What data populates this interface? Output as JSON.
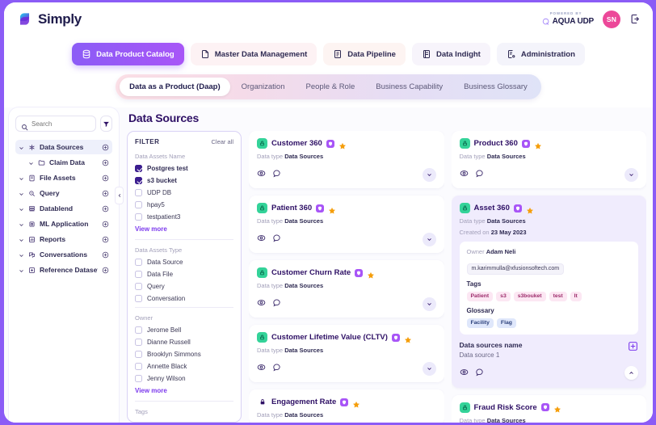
{
  "header": {
    "brand": "Simply",
    "brand_logo_icon": "simply-logo-icon",
    "powered_by_label": "POWERED BY",
    "powered_by_name": "AQUA UDP",
    "avatar_initials": "SN",
    "logout_icon": "logout-icon",
    "avatar_color": "#ec4899"
  },
  "main_nav": {
    "tabs": [
      {
        "label": "Data Product Catalog",
        "icon": "database-icon",
        "active": true
      },
      {
        "label": "Master Data Management",
        "icon": "document-icon",
        "active": false
      },
      {
        "label": "Data Pipeline",
        "icon": "list-document-icon",
        "active": false
      },
      {
        "label": "Data Indight",
        "icon": "book-icon",
        "active": false
      },
      {
        "label": "Administration",
        "icon": "admin-document-icon",
        "active": false
      }
    ]
  },
  "sub_nav": {
    "tabs": [
      {
        "label": "Data as a Product (Daap)",
        "active": true
      },
      {
        "label": "Organization",
        "active": false
      },
      {
        "label": "People & Role",
        "active": false
      },
      {
        "label": "Business Capability",
        "active": false
      },
      {
        "label": "Business Glossary",
        "active": false
      }
    ]
  },
  "sidebar": {
    "search": {
      "placeholder": "Search",
      "value": "",
      "icon": "search-icon"
    },
    "filter_button_icon": "filter-funnel-icon",
    "collapse_handle_icon": "chevron-left-icon",
    "items": [
      {
        "label": "Data Sources",
        "icon": "asterisk-icon",
        "selected": true,
        "child": false
      },
      {
        "label": "Claim Data",
        "icon": "folder-icon",
        "selected": false,
        "child": true
      },
      {
        "label": "File Assets",
        "icon": "file-icon",
        "selected": false,
        "child": false
      },
      {
        "label": "Query",
        "icon": "search-code-icon",
        "selected": false,
        "child": false
      },
      {
        "label": "Datablend",
        "icon": "layers-icon",
        "selected": false,
        "child": false
      },
      {
        "label": "ML Application",
        "icon": "chip-icon",
        "selected": false,
        "child": false
      },
      {
        "label": "Reports",
        "icon": "chart-icon",
        "selected": false,
        "child": false
      },
      {
        "label": "Conversations",
        "icon": "chat-icon",
        "selected": false,
        "child": false
      },
      {
        "label": "Reference Datasets",
        "icon": "dataset-icon",
        "selected": false,
        "child": false
      }
    ]
  },
  "main": {
    "page_title": "Data Sources",
    "filter_panel": {
      "title": "FILTER",
      "clear_all": "Clear all",
      "view_more": "View more",
      "groups": [
        {
          "label": "Data Assets Name",
          "options": [
            {
              "label": "Postgres test",
              "checked": true
            },
            {
              "label": "s3 bucket",
              "checked": true
            },
            {
              "label": "UDP DB",
              "checked": false
            },
            {
              "label": "hpay5",
              "checked": false
            },
            {
              "label": "testpatient3",
              "checked": false
            }
          ],
          "has_view_more": true
        },
        {
          "label": "Data Assets Type",
          "options": [
            {
              "label": "Data Source",
              "checked": false
            },
            {
              "label": "Data File",
              "checked": false
            },
            {
              "label": "Query",
              "checked": false
            },
            {
              "label": "Conversation",
              "checked": false
            }
          ],
          "has_view_more": false
        },
        {
          "label": "Owner",
          "options": [
            {
              "label": "Jerome Bell",
              "checked": false
            },
            {
              "label": "Dianne Russell",
              "checked": false
            },
            {
              "label": "Brooklyn Simmons",
              "checked": false
            },
            {
              "label": "Annette Black",
              "checked": false
            },
            {
              "label": "Jenny Wilson",
              "checked": false
            }
          ],
          "has_view_more": true
        },
        {
          "label": "Tags",
          "options": [],
          "has_view_more": false
        }
      ]
    },
    "card_labels": {
      "data_type_prefix": "Data type",
      "created_on_prefix": "Created on",
      "owner_prefix": "Owner",
      "tags_title": "Tags",
      "glossary_title": "Glossary",
      "data_sources_name_label": "Data sources name",
      "view_icon": "eye-icon",
      "comment_icon": "comment-icon",
      "expand_icon": "chevron-down-icon",
      "collapse_icon": "chevron-up-icon",
      "shield_badge_icon": "shield-icon",
      "star_badge_icon": "star-icon",
      "lock_icon": "lock-icon",
      "dataset_icon": "dataset-icon"
    },
    "column_left": [
      {
        "name": "Customer 360",
        "data_type": "Data Sources",
        "lock_style": "green"
      },
      {
        "name": "Patient 360",
        "data_type": "Data Sources",
        "lock_style": "green"
      },
      {
        "name": "Customer Churn Rate",
        "data_type": "Data Sources",
        "lock_style": "green"
      },
      {
        "name": "Customer Lifetime Value (CLTV)",
        "data_type": "Data Sources",
        "lock_style": "green"
      },
      {
        "name": "Engagement Rate",
        "data_type": "Data Sources",
        "lock_style": "dark"
      }
    ],
    "column_right": [
      {
        "name": "Product 360",
        "data_type": "Data Sources",
        "lock_style": "green"
      },
      {
        "name": "Asset 360",
        "data_type": "Data Sources",
        "lock_style": "green",
        "expanded": true,
        "created_on": "23 May 2023",
        "owner_name": "Adam Neli",
        "owner_email": "m.karimmulla@xfusionsoftech.com",
        "tags": [
          "Patient",
          "s3",
          "s3bouket",
          "test",
          "It"
        ],
        "glossary": [
          "Facility",
          "Flag"
        ],
        "data_source_value": "Data source 1"
      },
      {
        "name": "Fraud Risk Score",
        "data_type": "Data Sources",
        "lock_style": "green"
      }
    ]
  }
}
